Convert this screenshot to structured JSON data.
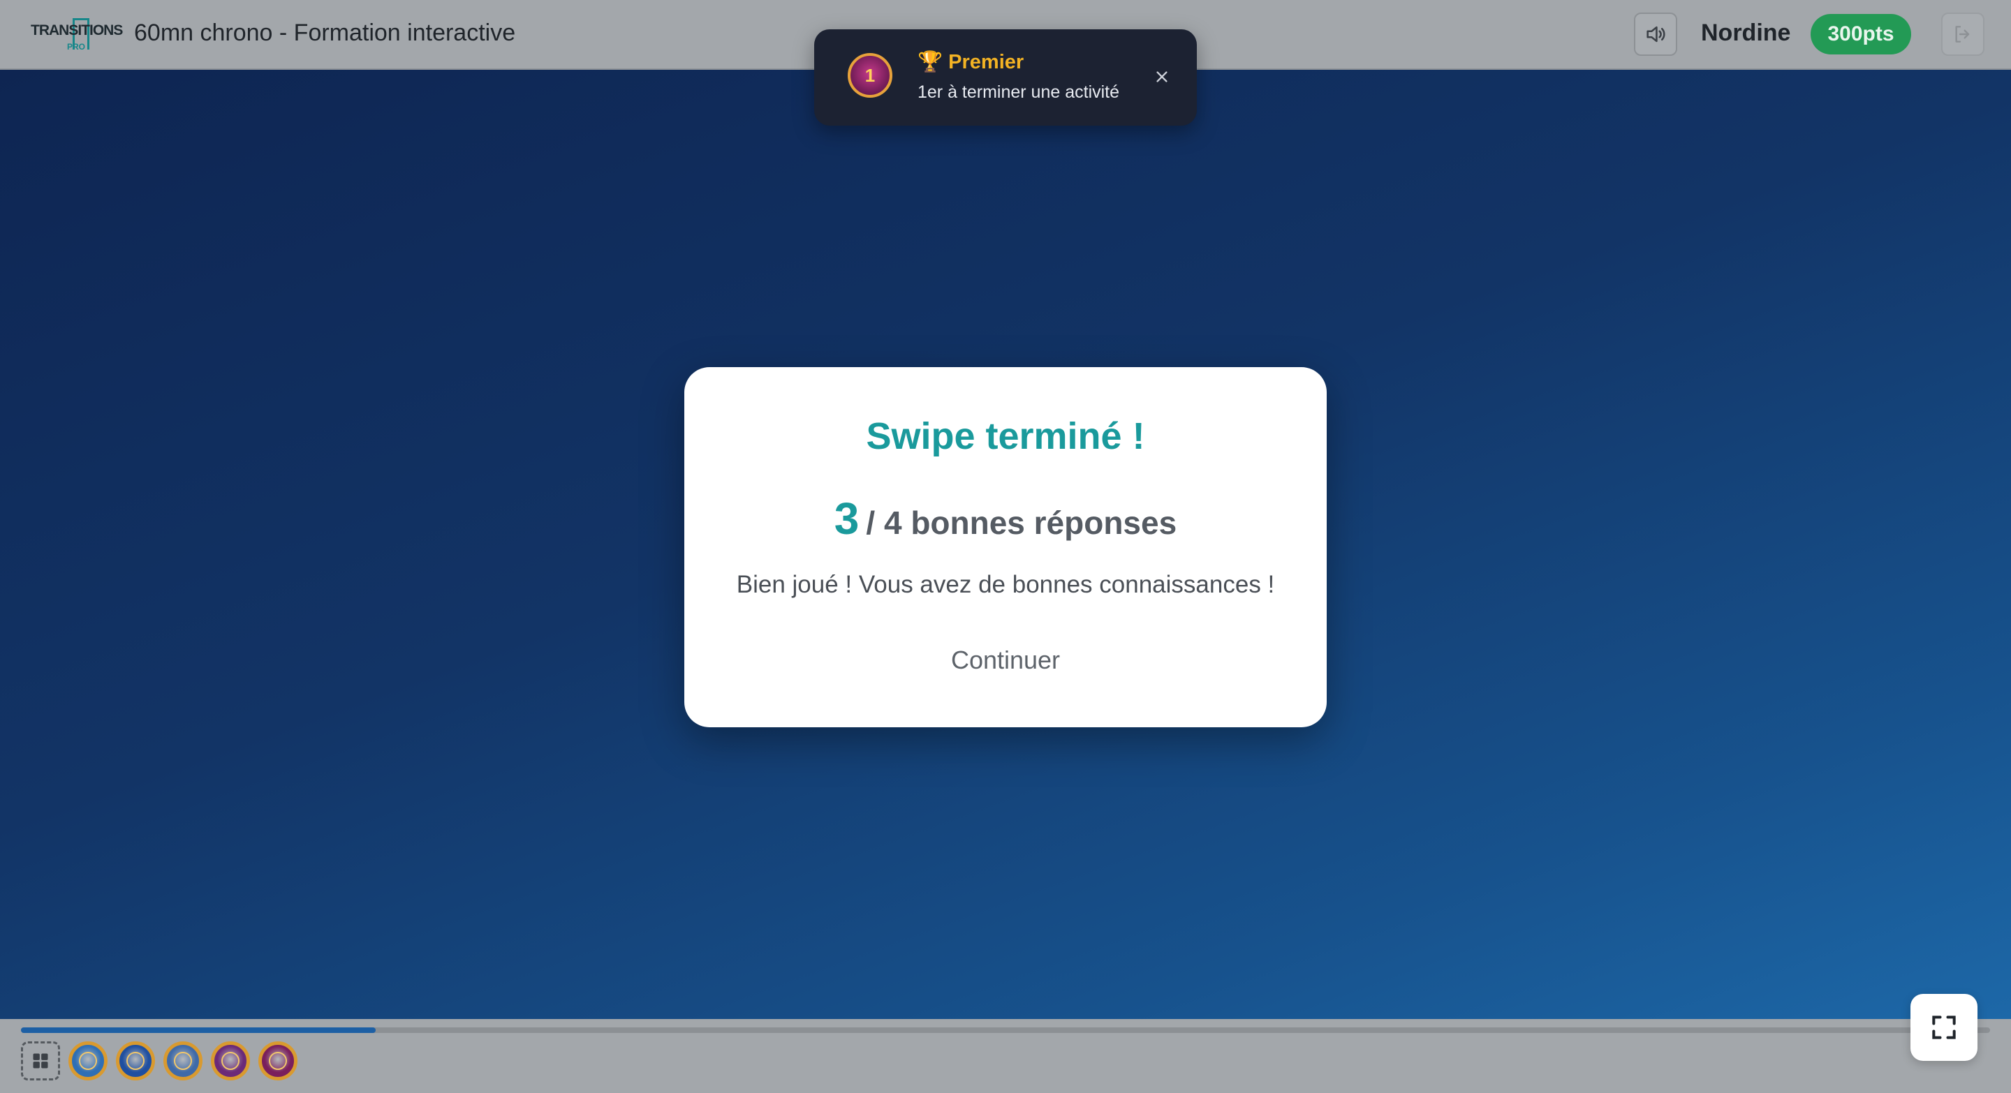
{
  "header": {
    "logo_text": "TRANSITIONS",
    "logo_sub_label": "PRO",
    "app_title": "60mn chrono - Formation interactive",
    "sound_icon": "speaker-icon",
    "user_name": "Nordine",
    "points": "300pts",
    "logout_icon": "logout-icon"
  },
  "toast": {
    "icon": "first-place-medal-icon",
    "medal_text": "1",
    "title": "🏆 Premier",
    "description": "1er à terminer une activité",
    "close_icon": "close-icon"
  },
  "modal": {
    "title": "Swipe terminé !",
    "score_value": "3",
    "score_rest": "/ 4 bonnes réponses",
    "message": "Bien joué ! Vous avez de bonnes connaissances !",
    "continue_label": "Continuer"
  },
  "footer": {
    "progress_fraction": 0.18,
    "grid_icon": "grid-icon",
    "badges": [
      {
        "name": "badge-blue-icon",
        "color": "#2f6fb5"
      },
      {
        "name": "badge-lightning-icon",
        "color": "#1f4fa0"
      },
      {
        "name": "badge-swipe-icon",
        "color": "#3f6aa8"
      },
      {
        "name": "badge-purple-icon",
        "color": "#6b2a78"
      },
      {
        "name": "badge-first-icon",
        "color": "#7a1f5c"
      }
    ],
    "fullscreen_icon": "fullscreen-icon"
  },
  "colors": {
    "accent_teal": "#1a9a9c",
    "points_green": "#239a55",
    "toast_title": "#f3b324",
    "toast_bg": "#1c2232"
  }
}
